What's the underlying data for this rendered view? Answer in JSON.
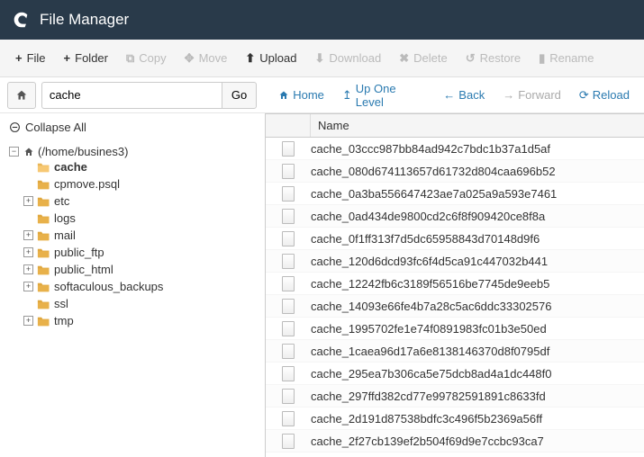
{
  "header": {
    "title": "File Manager"
  },
  "toolbar": {
    "file": "File",
    "folder": "Folder",
    "copy": "Copy",
    "move": "Move",
    "upload": "Upload",
    "download": "Download",
    "delete": "Delete",
    "restore": "Restore",
    "rename": "Rename"
  },
  "nav": {
    "path_value": "cache",
    "go": "Go",
    "home": "Home",
    "up": "Up One Level",
    "back": "Back",
    "forward": "Forward",
    "reload": "Reload"
  },
  "sidebar": {
    "collapse": "Collapse All",
    "root": "(/home/busines3)",
    "items": [
      {
        "label": "cache",
        "bold": true,
        "exp": ""
      },
      {
        "label": "cpmove.psql",
        "exp": ""
      },
      {
        "label": "etc",
        "exp": "+"
      },
      {
        "label": "logs",
        "exp": ""
      },
      {
        "label": "mail",
        "exp": "+"
      },
      {
        "label": "public_ftp",
        "exp": "+"
      },
      {
        "label": "public_html",
        "exp": "+"
      },
      {
        "label": "softaculous_backups",
        "exp": "+"
      },
      {
        "label": "ssl",
        "exp": ""
      },
      {
        "label": "tmp",
        "exp": "+"
      }
    ]
  },
  "grid": {
    "name_header": "Name",
    "rows": [
      "cache_03ccc987bb84ad942c7bdc1b37a1d5af",
      "cache_080d674113657d61732d804caa696b52",
      "cache_0a3ba556647423ae7a025a9a593e7461",
      "cache_0ad434de9800cd2c6f8f909420ce8f8a",
      "cache_0f1ff313f7d5dc65958843d70148d9f6",
      "cache_120d6dcd93fc6f4d5ca91c447032b441",
      "cache_12242fb6c3189f56516be7745de9eeb5",
      "cache_14093e66fe4b7a28c5ac6ddc33302576",
      "cache_1995702fe1e74f0891983fc01b3e50ed",
      "cache_1caea96d17a6e8138146370d8f0795df",
      "cache_295ea7b306ca5e75dcb8ad4a1dc448f0",
      "cache_297ffd382cd77e99782591891c8633fd",
      "cache_2d191d87538bdfc3c496f5b2369a56ff",
      "cache_2f27cb139ef2b504f69d9e7ccbc93ca7"
    ]
  }
}
